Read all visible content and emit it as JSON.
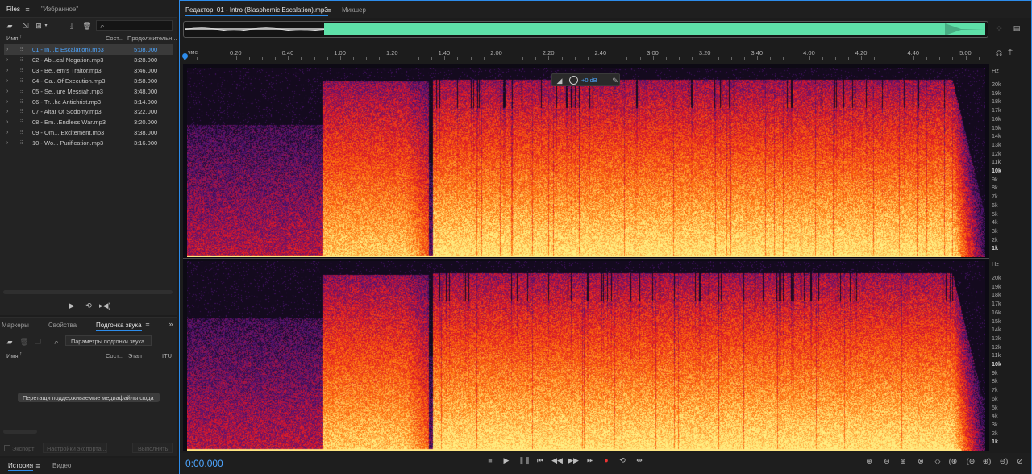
{
  "files_panel": {
    "tab_files": "Files",
    "tab_favorites": "\"Избранное\"",
    "search_placeholder": "",
    "col_name": "Имя",
    "col_state": "Сост...",
    "col_duration": "Продолжительн...",
    "files": [
      {
        "name": "01 - In...ic Escalation).mp3",
        "duration": "5:08.000",
        "selected": true
      },
      {
        "name": "02 - Ab...cal Negation.mp3",
        "duration": "3:28.000"
      },
      {
        "name": "03 - Be...em's Traitor.mp3",
        "duration": "3:46.000"
      },
      {
        "name": "04 - Ca...Of Execution.mp3",
        "duration": "3:58.000"
      },
      {
        "name": "05 - Se...ure Messiah.mp3",
        "duration": "3:48.000"
      },
      {
        "name": "06 - Tr...he Antichrist.mp3",
        "duration": "3:14.000"
      },
      {
        "name": "07 - Altar Of Sodomy.mp3",
        "duration": "3:22.000"
      },
      {
        "name": "08 - Em...Endless War.mp3",
        "duration": "3:20.000"
      },
      {
        "name": "09 - Om... Excitement.mp3",
        "duration": "3:38.000"
      },
      {
        "name": "10 - Wo... Purification.mp3",
        "duration": "3:16.000"
      }
    ]
  },
  "lower_panel": {
    "tab_markers": "Маркеры",
    "tab_properties": "Свойства",
    "tab_match": "Подгонка звука",
    "params_button": "Параметры подгонки звука",
    "col_name": "Имя",
    "col_state": "Сост...",
    "col_stage": "Этап",
    "col_itu": "ITU",
    "drop_hint": "Перетащи поддерживаемые медиафайлы сюда",
    "export_label": "Экспорт",
    "export_settings": "Настройки экспорта...",
    "run_button": "Выполнить"
  },
  "bottom_tabs": {
    "history": "История",
    "video": "Видео"
  },
  "editor": {
    "tab_editor": "Редактор: 01 - Intro (Blasphemic Escalation).mp3",
    "tab_mixer": "Микшер",
    "hud_gain": "+0 dB",
    "timecode": "0:00.000",
    "ruler_unit": "чмс",
    "ruler_ticks": [
      "0:20",
      "0:40",
      "1:00",
      "1:20",
      "1:40",
      "2:00",
      "2:20",
      "2:40",
      "3:00",
      "3:20",
      "3:40",
      "4:00",
      "4:20",
      "4:40",
      "5:00"
    ],
    "hz_unit": "Hz",
    "hz_labels": [
      "20k",
      "19k",
      "18k",
      "17k",
      "16k",
      "15k",
      "14k",
      "13k",
      "12k",
      "11k",
      "10k",
      "9k",
      "8k",
      "7k",
      "6k",
      "5k",
      "4k",
      "3k",
      "2k",
      "1k"
    ]
  },
  "colors": {
    "accent": "#2d8ceb",
    "overview_wave": "#5ee0a8",
    "spectrum_hot": "#ffe680",
    "spectrum_mid": "#ff4a10",
    "spectrum_low": "#4a1a7a"
  }
}
